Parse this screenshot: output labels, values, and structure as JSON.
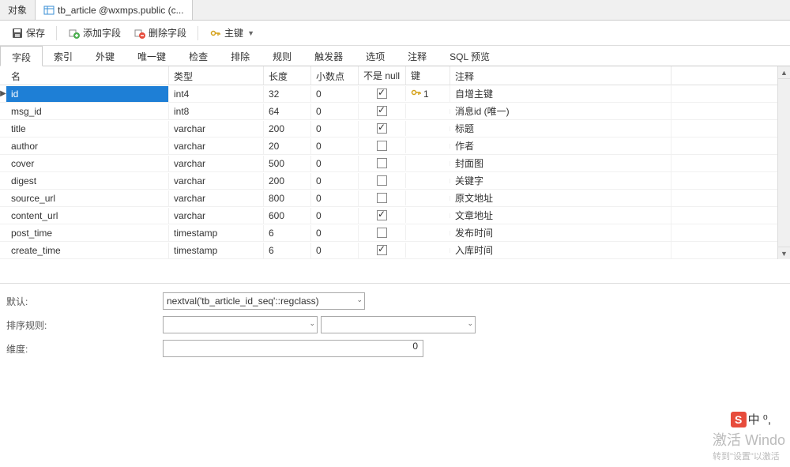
{
  "tabs": {
    "items": [
      {
        "label": "对象",
        "active": false
      },
      {
        "label": "tb_article @wxmps.public (c...",
        "active": true
      }
    ]
  },
  "toolbar": {
    "save": "保存",
    "addField": "添加字段",
    "deleteField": "删除字段",
    "primaryKey": "主键"
  },
  "subtabs": {
    "items": [
      "字段",
      "索引",
      "外键",
      "唯一键",
      "检查",
      "排除",
      "规则",
      "触发器",
      "选项",
      "注释",
      "SQL 预览"
    ],
    "activeIndex": 0
  },
  "grid": {
    "headers": {
      "name": "名",
      "type": "类型",
      "length": "长度",
      "decimal": "小数点",
      "notnull": "不是 null",
      "key": "键",
      "comment": "注释"
    },
    "rows": [
      {
        "name": "id",
        "type": "int4",
        "length": "32",
        "decimal": "0",
        "notnull": true,
        "key": "1",
        "comment": "自增主键",
        "selected": true
      },
      {
        "name": "msg_id",
        "type": "int8",
        "length": "64",
        "decimal": "0",
        "notnull": true,
        "key": "",
        "comment": "消息id (唯一)",
        "selected": false
      },
      {
        "name": "title",
        "type": "varchar",
        "length": "200",
        "decimal": "0",
        "notnull": true,
        "key": "",
        "comment": "标题",
        "selected": false
      },
      {
        "name": "author",
        "type": "varchar",
        "length": "20",
        "decimal": "0",
        "notnull": false,
        "key": "",
        "comment": "作者",
        "selected": false
      },
      {
        "name": "cover",
        "type": "varchar",
        "length": "500",
        "decimal": "0",
        "notnull": false,
        "key": "",
        "comment": "封面图",
        "selected": false
      },
      {
        "name": "digest",
        "type": "varchar",
        "length": "200",
        "decimal": "0",
        "notnull": false,
        "key": "",
        "comment": "关键字",
        "selected": false
      },
      {
        "name": "source_url",
        "type": "varchar",
        "length": "800",
        "decimal": "0",
        "notnull": false,
        "key": "",
        "comment": "原文地址",
        "selected": false
      },
      {
        "name": "content_url",
        "type": "varchar",
        "length": "600",
        "decimal": "0",
        "notnull": true,
        "key": "",
        "comment": "文章地址",
        "selected": false
      },
      {
        "name": "post_time",
        "type": "timestamp",
        "length": "6",
        "decimal": "0",
        "notnull": false,
        "key": "",
        "comment": "发布时间",
        "selected": false
      },
      {
        "name": "create_time",
        "type": "timestamp",
        "length": "6",
        "decimal": "0",
        "notnull": true,
        "key": "",
        "comment": "入库时间",
        "selected": false
      }
    ]
  },
  "form": {
    "defaultLabel": "默认:",
    "defaultValue": "nextval('tb_article_id_seq'::regclass)",
    "collationLabel": "排序规则:",
    "dimensionLabel": "维度:",
    "dimensionValue": "0"
  },
  "watermark": {
    "line1": "激活 Windo",
    "line2": "转到\"设置\"以激活"
  },
  "ime": {
    "letter": "S",
    "text": "中 ⁰,"
  }
}
